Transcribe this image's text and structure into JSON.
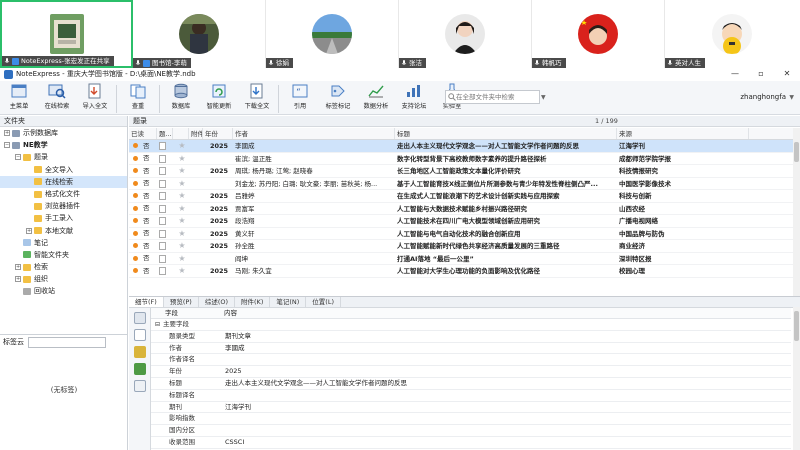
{
  "meeting": {
    "tiles": [
      {
        "name": "NoteExpress-张宏发正在共享",
        "kind": "screen"
      },
      {
        "name": "图书馆-李萌",
        "kind": "user"
      },
      {
        "name": "徐娟",
        "kind": "user"
      },
      {
        "name": "张洁",
        "kind": "user"
      },
      {
        "name": "韩帆巧",
        "kind": "user"
      },
      {
        "name": "英对人生",
        "kind": "user"
      }
    ]
  },
  "window": {
    "title": "NoteExpress - 重庆大学图书馆版 - D:\\桌面\\NE教学.ndb",
    "min": "—",
    "max": "▫",
    "close": "✕"
  },
  "toolbar": {
    "buttons": [
      {
        "label": "主菜单",
        "icon": "menu-icon"
      },
      {
        "label": "在线检索",
        "icon": "online-search-icon"
      },
      {
        "label": "导入全文",
        "icon": "import-icon"
      },
      {
        "label": "查重",
        "icon": "dedupe-icon"
      },
      {
        "label": "数据库",
        "icon": "database-icon"
      },
      {
        "label": "智能更新",
        "icon": "smart-update-icon"
      },
      {
        "label": "下载全文",
        "icon": "download-icon"
      },
      {
        "label": "引用",
        "icon": "cite-icon"
      },
      {
        "label": "标签标记",
        "icon": "tag-icon"
      },
      {
        "label": "数据分析",
        "icon": "analysis-icon"
      },
      {
        "label": "支持论坛",
        "icon": "forum-icon"
      },
      {
        "label": "实验室",
        "icon": "lab-icon"
      }
    ],
    "search_placeholder": "在全部文件夹中检索",
    "user": "zhanghongfa"
  },
  "left": {
    "header": "文件夹",
    "tree": [
      {
        "label": "示例数据库",
        "level": 0,
        "icon": "db",
        "twisty": "+"
      },
      {
        "label": "NE教学",
        "level": 0,
        "icon": "db",
        "twisty": "−",
        "bold": true
      },
      {
        "label": "题录",
        "level": 1,
        "icon": "folder",
        "twisty": "−"
      },
      {
        "label": "全文导入",
        "level": 2,
        "icon": "folder"
      },
      {
        "label": "在线检索",
        "level": 2,
        "icon": "folder",
        "selected": true
      },
      {
        "label": "格式化文件",
        "level": 2,
        "icon": "folder"
      },
      {
        "label": "浏览器插件",
        "level": 2,
        "icon": "folder"
      },
      {
        "label": "手工录入",
        "level": 2,
        "icon": "folder"
      },
      {
        "label": "本地文献",
        "level": 2,
        "icon": "folder",
        "twisty": "+"
      },
      {
        "label": "笔记",
        "level": 1,
        "icon": "note"
      },
      {
        "label": "智能文件夹",
        "level": 1,
        "icon": "smart"
      },
      {
        "label": "检索",
        "level": 1,
        "icon": "folder",
        "twisty": "+"
      },
      {
        "label": "组织",
        "level": 1,
        "icon": "folder",
        "twisty": "+"
      },
      {
        "label": "回收站",
        "level": 1,
        "icon": "trash"
      }
    ],
    "tag_cloud_label": "标签云",
    "no_tag": "(无标签)"
  },
  "main": {
    "header": "题录",
    "counter": "1 / 199",
    "columns": [
      "已读",
      "题...",
      "",
      "附件",
      "年份",
      "作者",
      "标题",
      "来源"
    ],
    "rows": [
      {
        "read": "否",
        "year": "2025",
        "author": "李國成",
        "title": "走出人本主义现代文学观念——对人工智能文学作者问题的反思",
        "source": "江海学刊",
        "selected": true
      },
      {
        "read": "否",
        "year": "",
        "author": "崔滨; 温正胜",
        "title": "数字化转型背景下高校教师数字素养的提升路径探析",
        "source": "成都师范学院学报"
      },
      {
        "read": "否",
        "year": "2025",
        "author": "周琪; 杨丹璐; 江莺; 赵晓春",
        "title": "长三角地区人工智能政策文本量化评价研究",
        "source": "科技情报研究"
      },
      {
        "read": "否",
        "year": "",
        "author": "刘金龙; 苏丹阳; 白璐; 耿文豪; 李丽; 苗秋英; 杨...",
        "title": "基于人工智能育技X线正侧位片所测参数与青少年特发性脊柱侧凸严...",
        "source": "中国医学影像技术"
      },
      {
        "read": "否",
        "year": "2025",
        "author": "吕雅婷",
        "title": "在生成式人工智能浪潮下的艺术设计创新实践与应用探索",
        "source": "科技与创新"
      },
      {
        "read": "否",
        "year": "2025",
        "author": "贾富军",
        "title": "人工智能与大数据技术赋能乡村振兴路径研究",
        "source": "山西农经"
      },
      {
        "read": "否",
        "year": "2025",
        "author": "段浩翔",
        "title": "人工智能技术在四川广电大模型领域创新应用研究",
        "source": "广播电视网络"
      },
      {
        "read": "否",
        "year": "2025",
        "author": "黄义轩",
        "title": "人工智能与电气自动化技术的融合创新应用",
        "source": "中国品牌与防伪"
      },
      {
        "read": "否",
        "year": "2025",
        "author": "孙全胜",
        "title": "人工智能赋能新时代绿色共享经济高质量发展的三重路径",
        "source": "商业经济"
      },
      {
        "read": "否",
        "year": "",
        "author": "阎坤",
        "title": "打通AI落地 “最后一公里”",
        "source": "深圳特区报"
      },
      {
        "read": "否",
        "year": "2025",
        "author": "马刚; 朱久宜",
        "title": "人工智能对大学生心理功能的负面影响及优化路径",
        "source": "校园心理"
      }
    ]
  },
  "detail": {
    "tabs": [
      "细节",
      "预览",
      "综述",
      "附件",
      "笔记",
      "位置"
    ],
    "tab_counts": [
      "(F)",
      "(P)",
      "(O)",
      "(K)",
      "(N)",
      "(L)"
    ],
    "col_field": "字段",
    "col_content": "内容",
    "group": "主要字段",
    "fields": [
      {
        "key": "题录类型",
        "value": "期刊文章"
      },
      {
        "key": "作者",
        "value": "李國成"
      },
      {
        "key": "作者译名",
        "value": ""
      },
      {
        "key": "年份",
        "value": "2025"
      },
      {
        "key": "标题",
        "value": "走出人本主义现代文学观念——对人工智能文学作者问题的反思"
      },
      {
        "key": "标题译名",
        "value": ""
      },
      {
        "key": "期刊",
        "value": "江海学刊"
      },
      {
        "key": "影响指数",
        "value": ""
      },
      {
        "key": "国内分区",
        "value": ""
      },
      {
        "key": "收录范围",
        "value": "CSSCI"
      }
    ]
  },
  "colors": {
    "accent": "#2f6fc0",
    "selected_row": "#cfe3fa",
    "unread_dot": "#f08a1c",
    "active_tile": "#2bbf6a"
  }
}
